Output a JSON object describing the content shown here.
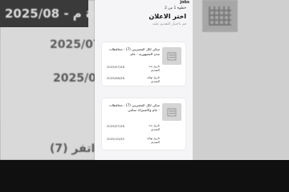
{
  "background": {
    "top_left_text": "2025/08 - م ap",
    "mid_left_text_1": "2025/07",
    "mid_left_text_2": "2025/08",
    "bottom_left_text": "(7) اتفر"
  },
  "screen": {
    "brand": "jobs",
    "step": "خطوة 1 من 2",
    "title": "اختر الاعلان",
    "subtitle": "قم باختيار التقديم عليه",
    "cards": [
      {
        "title": "سكن لكل المصريين (7) - محافظات مدن الجمهورية - عام",
        "start_label": "تاريخ بدء التقديم",
        "start_value": "2025/07/28",
        "end_label": "تاريخ نهاية التقديم",
        "end_value": "2025/08/28"
      },
      {
        "title": "سكن لكل المصريين (7) - محافظات - عام والاشتراك سكني",
        "start_label": "تاريخ بدء التقديم",
        "start_value": "2025/07/28",
        "end_label": "تاريخ نهاية التقديم",
        "end_value": "2025/10/30"
      }
    ]
  }
}
